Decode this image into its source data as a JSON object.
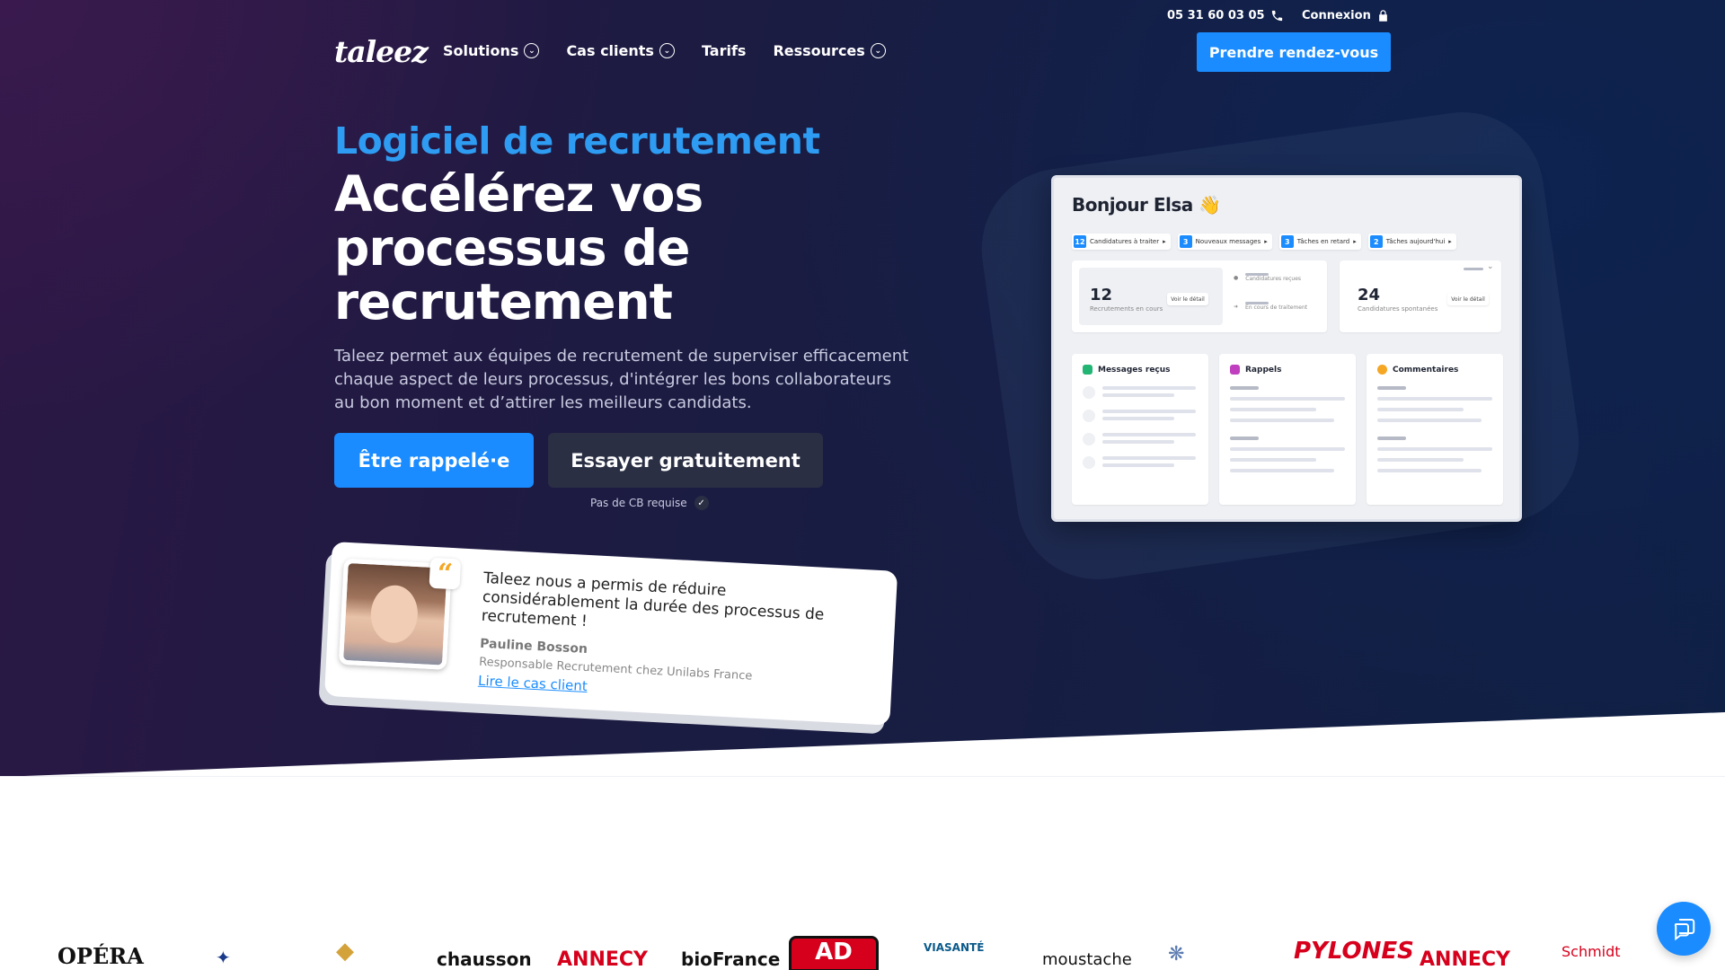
{
  "topbar": {
    "phone": "05 31 60 03 05",
    "login": "Connexion"
  },
  "nav": {
    "logo": "taleez",
    "items": [
      {
        "label": "Solutions",
        "dropdown": true
      },
      {
        "label": "Cas clients",
        "dropdown": true
      },
      {
        "label": "Tarifs",
        "dropdown": false
      },
      {
        "label": "Ressources",
        "dropdown": true
      }
    ],
    "cta": "Prendre rendez-vous"
  },
  "hero": {
    "eyebrow": "Logiciel de recrutement",
    "headline": "Accélérez vos processus de recrutement",
    "lead": "Taleez permet aux équipes de recrutement de superviser efficacement chaque aspect de leurs processus, d'intégrer les bons collaborateurs au bon moment et d’attirer les meilleurs candidats.",
    "btn_primary": "Être rappelé·e",
    "btn_secondary": "Essayer gratuitement",
    "note": "Pas de CB requise"
  },
  "testimonial": {
    "quote": "Taleez nous a permis de réduire considérablement la durée des processus de recrutement !",
    "name": "Pauline Bosson",
    "role": "Responsable Recrutement chez Unilabs France",
    "link": "Lire le cas client"
  },
  "dashboard": {
    "title": "Bonjour Elsa 👋",
    "pills": [
      {
        "num": "12",
        "label": "Candidatures à traiter"
      },
      {
        "num": "3",
        "label": "Nouveaux messages"
      },
      {
        "num": "3",
        "label": "Tâches en retard"
      },
      {
        "num": "2",
        "label": "Tâches aujourd'hui"
      }
    ],
    "stat1": {
      "num": "12",
      "label": "Recrutements en cours",
      "btn": "Voir le détail"
    },
    "stat_mini": {
      "a": "Candidatures reçues",
      "b": "En cours de traitement"
    },
    "stat2": {
      "num": "24",
      "label": "Candidatures spontanées",
      "btn": "Voir le détail"
    },
    "panels": [
      "Messages reçus",
      "Rappels",
      "Commentaires"
    ],
    "colors": {
      "messages": "#22b573",
      "rappels": "#c03fbf",
      "commentaires": "#f5a623"
    }
  },
  "logos": [
    "OPÉRA",
    "chausson",
    "ANNECY",
    "bioFrance",
    "AD",
    "VIASANTÉ",
    "moustache",
    "PYLONES",
    "ANNECY",
    "Schmidt"
  ],
  "colors": {
    "accent": "#1a8cff",
    "eyebrow": "#2e9cf2",
    "dark_button": "#2a2f44"
  }
}
